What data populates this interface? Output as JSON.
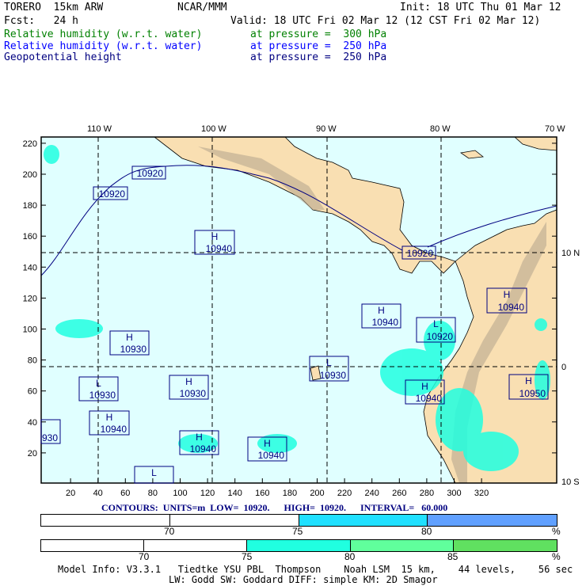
{
  "header": {
    "model": "TORERO  15km ARW",
    "org": "NCAR/MMM",
    "init": "Init: 18 UTC Thu 01 Mar 12",
    "fcst": "Fcst:   24 h",
    "valid": "Valid: 18 UTC Fri 02 Mar 12 (12 CST Fri 02 Mar 12)",
    "fields": [
      {
        "name": "Relative humidity (w.r.t. water)",
        "level": "at pressure =  300 hPa",
        "color": "#008000"
      },
      {
        "name": "Relative humidity (w.r.t. water)",
        "level": "at pressure =  250 hPa",
        "color": "#0000ff"
      },
      {
        "name": "Geopotential height",
        "level": "at pressure =  250 hPa",
        "color": "#000080"
      }
    ]
  },
  "map": {
    "lon_labels": [
      "110 W",
      "100 W",
      "90 W",
      "80 W",
      "70 W"
    ],
    "lat_labels": [
      "10 N",
      "0",
      "10 S"
    ],
    "x_ticks": [
      "20",
      "40",
      "60",
      "80",
      "100",
      "120",
      "140",
      "160",
      "180",
      "200",
      "220",
      "240",
      "260",
      "280",
      "300",
      "320"
    ],
    "y_ticks": [
      "220",
      "200",
      "180",
      "160",
      "140",
      "120",
      "100",
      "80",
      "60",
      "40",
      "20"
    ],
    "contour_labels": [
      {
        "t": "",
        "v": "10920"
      },
      {
        "t": "",
        "v": "10920"
      },
      {
        "t": "H",
        "v": "10940"
      },
      {
        "t": "",
        "v": "10920"
      },
      {
        "t": "H",
        "v": "10940"
      },
      {
        "t": "L",
        "v": "10920"
      },
      {
        "t": "H",
        "v": "10940"
      },
      {
        "t": "H",
        "v": "10930"
      },
      {
        "t": "L",
        "v": "10930"
      },
      {
        "t": "L",
        "v": "10930"
      },
      {
        "t": "H",
        "v": "10930"
      },
      {
        "t": "H",
        "v": "10940"
      },
      {
        "t": "H",
        "v": "10950"
      },
      {
        "t": "H",
        "v": "10940"
      },
      {
        "t": "H",
        "v": "10940"
      },
      {
        "t": "H",
        "v": "10940"
      },
      {
        "t": "",
        "v": "930"
      },
      {
        "t": "L",
        "v": ""
      }
    ]
  },
  "contours_info": "CONTOURS:  UNITS=m  LOW=  10920.      HIGH=  10920.      INTERVAL=   60.000",
  "colorbar1": {
    "labels": [
      "70",
      "75",
      "80",
      "%"
    ],
    "colors": [
      "#ffffff",
      "#ffffff",
      "#20e0ff",
      "#60a0ff"
    ]
  },
  "colorbar2": {
    "labels": [
      "70",
      "75",
      "80",
      "85",
      "%"
    ],
    "colors": [
      "#ffffff",
      "#ffffff",
      "#20ffe0",
      "#60ff9c",
      "#60e060"
    ]
  },
  "footer": {
    "line1": "Model Info: V3.3.1   Tiedtke YSU PBL  Thompson    Noah LSM  15 km,    44 levels,    56 sec",
    "line2": "LW: Godd SW: Goddard DIFF: simple KM: 2D Smagor"
  }
}
